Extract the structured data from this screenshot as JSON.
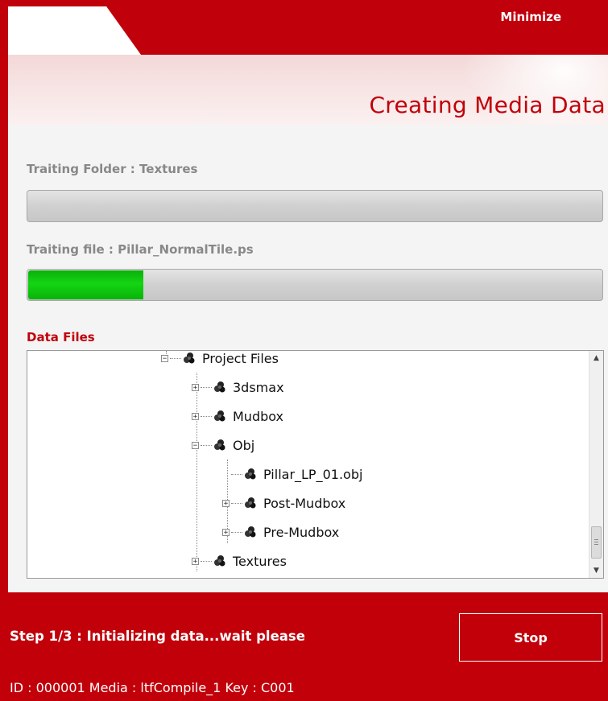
{
  "window": {
    "minimize_label": "Minimize",
    "title": "Creating Media Data"
  },
  "progress": {
    "folder_label": "Traiting Folder : Textures",
    "folder_fraction": 0.0,
    "file_label": "Traiting file : Pillar_NormalTile.ps",
    "file_fraction": 0.2
  },
  "data_files": {
    "section_label": "Data Files",
    "tree": [
      {
        "label": "Project Files",
        "expander": "minus"
      },
      {
        "label": "3dsmax",
        "expander": "plus"
      },
      {
        "label": "Mudbox",
        "expander": "plus"
      },
      {
        "label": "Obj",
        "expander": "minus"
      },
      {
        "label": "Pillar_LP_01.obj",
        "expander": "none"
      },
      {
        "label": "Post-Mudbox",
        "expander": "plus"
      },
      {
        "label": "Pre-Mudbox",
        "expander": "plus"
      },
      {
        "label": "Textures",
        "expander": "plus"
      }
    ]
  },
  "status": {
    "message": "Step 1/3 : Initializing data...wait please",
    "stop_label": "Stop"
  },
  "footer": {
    "info": "ID : 000001  Media : ltfCompile_1  Key : C001"
  },
  "colors": {
    "brand_red": "#c1000a",
    "progress_green": "#14d514"
  }
}
